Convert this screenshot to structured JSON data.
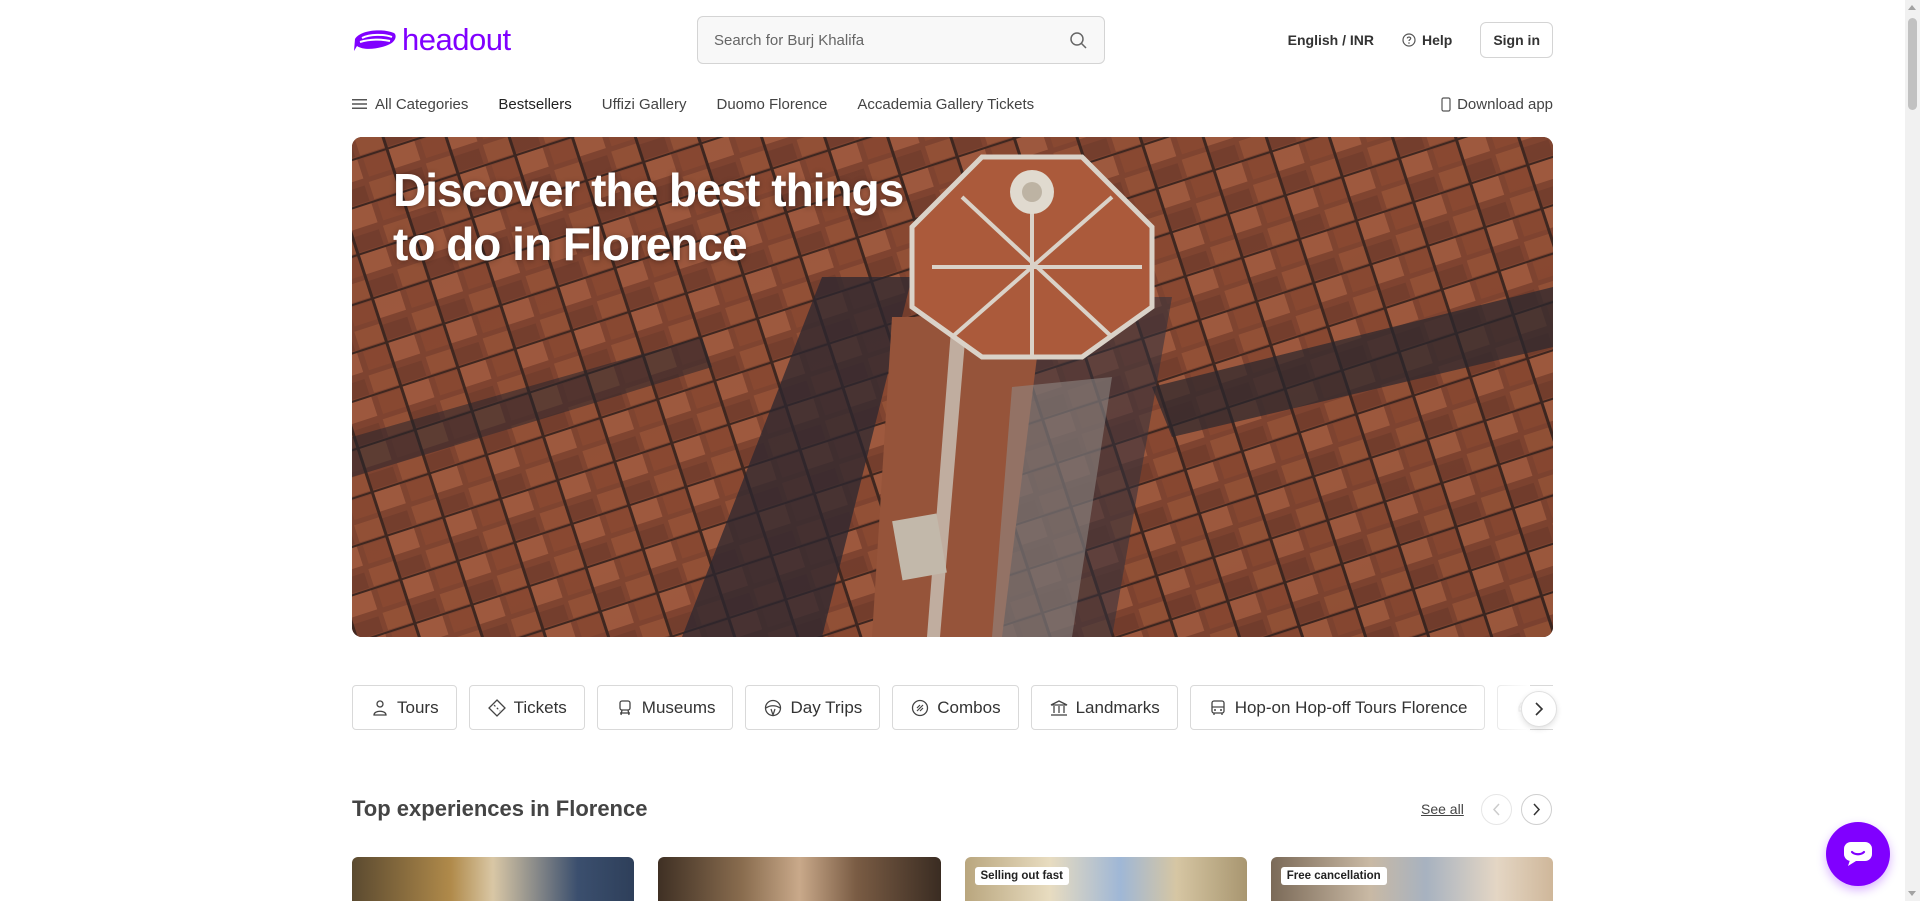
{
  "brand": {
    "name": "headout",
    "color": "#8000ff"
  },
  "search": {
    "placeholder": "Search for Burj Khalifa"
  },
  "header": {
    "language": "English / INR",
    "help": "Help",
    "signin": "Sign in"
  },
  "subnav": {
    "all_categories": "All Categories",
    "items": [
      "Bestsellers",
      "Uffizi Gallery",
      "Duomo Florence",
      "Accademia Gallery Tickets"
    ],
    "download": "Download app"
  },
  "hero": {
    "title": "Discover the best things to do in Florence"
  },
  "categories": [
    {
      "label": "Tours",
      "icon": "tour-guide-icon"
    },
    {
      "label": "Tickets",
      "icon": "ticket-icon"
    },
    {
      "label": "Museums",
      "icon": "museum-icon"
    },
    {
      "label": "Day Trips",
      "icon": "globe-icon"
    },
    {
      "label": "Combos",
      "icon": "combo-icon"
    },
    {
      "label": "Landmarks",
      "icon": "landmark-icon"
    },
    {
      "label": "Hop-on Hop-off Tours Florence",
      "icon": "bus-icon"
    },
    {
      "label": "",
      "icon": "car-icon"
    }
  ],
  "section": {
    "title": "Top experiences in Florence",
    "see_all": "See all"
  },
  "cards": [
    {
      "badge": ""
    },
    {
      "badge": ""
    },
    {
      "badge": "Selling out fast"
    },
    {
      "badge": "Free cancellation"
    }
  ]
}
